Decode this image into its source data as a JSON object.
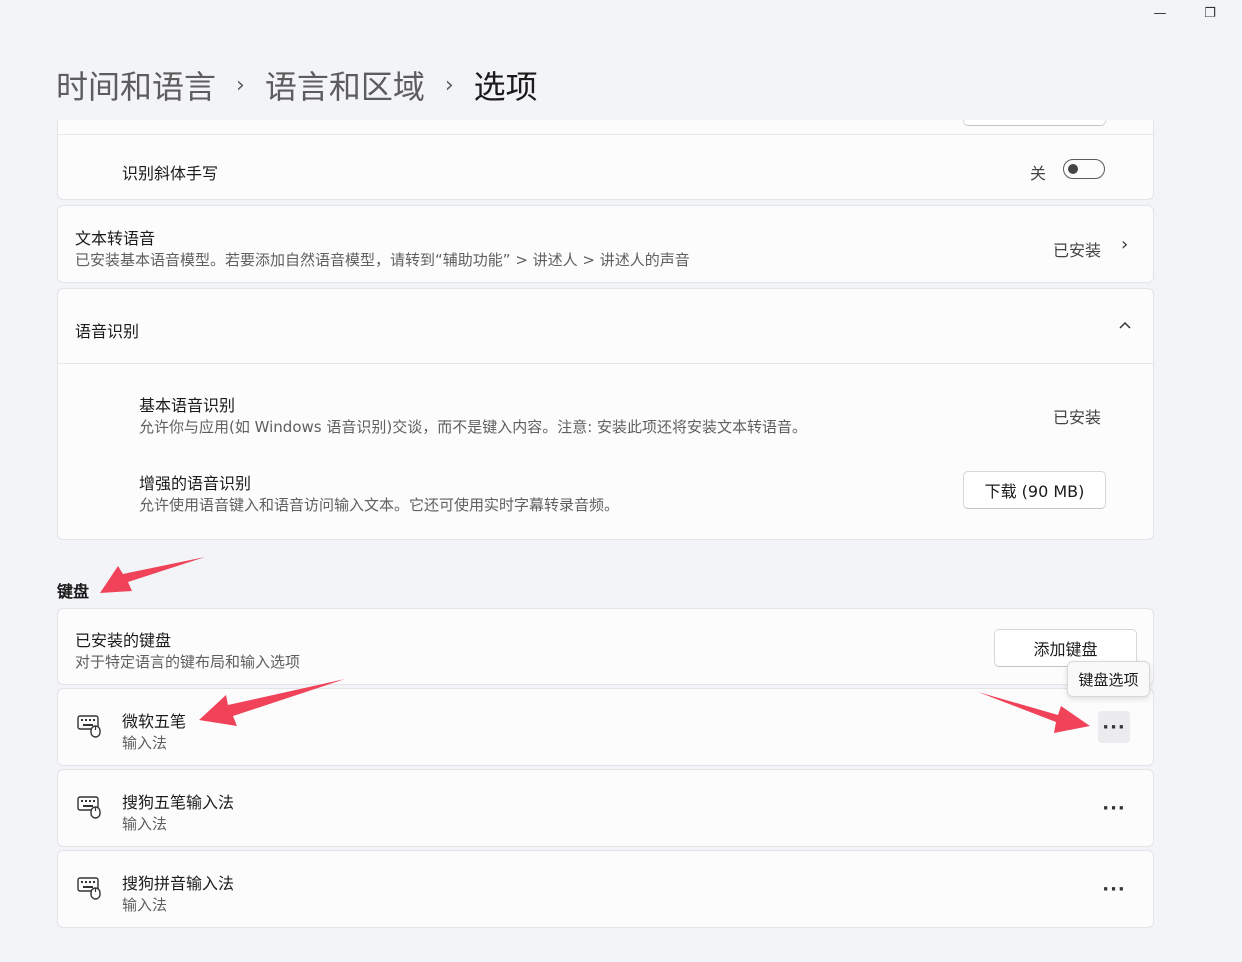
{
  "window": {
    "minimize_glyph": "—",
    "restore_glyph": "❐"
  },
  "breadcrumb": {
    "items": [
      "时间和语言",
      "语言和区域"
    ],
    "separator": "›",
    "current": "选项"
  },
  "handwriting": {
    "label": "识别斜体手写",
    "toggle_state": "关"
  },
  "tts": {
    "title": "文本转语音",
    "description": "已安装基本语音模型。若要添加自然语音模型，请转到“辅助功能” > 讲述人 > 讲述人的声音",
    "status": "已安装"
  },
  "speech": {
    "title": "语音识别",
    "items": [
      {
        "title": "基本语音识别",
        "description": "允许你与应用(如 Windows 语音识别)交谈，而不是键入内容。注意: 安装此项还将安装文本转语音。",
        "status": "已安装"
      },
      {
        "title": "增强的语音识别",
        "description": "允许使用语音键入和语音访问输入文本。它还可使用实时字幕转录音频。",
        "button": "下载 (90 MB)"
      }
    ]
  },
  "keyboard": {
    "section_title": "键盘",
    "installed": {
      "title": "已安装的键盘",
      "description": "对于特定语言的键布局和输入选项",
      "button": "添加键盘"
    },
    "tooltip": "键盘选项",
    "more_glyph": "···",
    "items": [
      {
        "name": "微软五笔",
        "type": "输入法"
      },
      {
        "name": "搜狗五笔输入法",
        "type": "输入法"
      },
      {
        "name": "搜狗拼音输入法",
        "type": "输入法"
      }
    ]
  },
  "annotation_color": "#f0435a"
}
